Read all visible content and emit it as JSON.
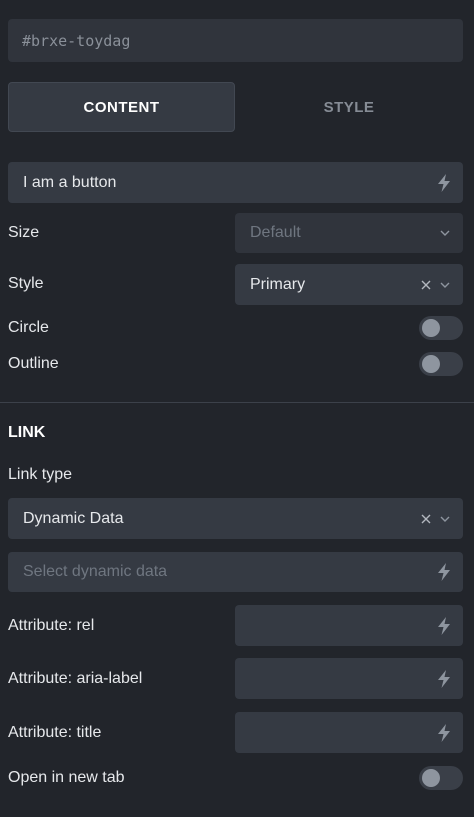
{
  "element_id": "#brxe-toydag",
  "tabs": [
    {
      "label": "CONTENT",
      "active": true
    },
    {
      "label": "STYLE",
      "active": false
    }
  ],
  "button_text": {
    "value": "I am a button"
  },
  "size": {
    "label": "Size",
    "placeholder": "Default"
  },
  "style": {
    "label": "Style",
    "value": "Primary"
  },
  "circle": {
    "label": "Circle",
    "on": false
  },
  "outline": {
    "label": "Outline",
    "on": false
  },
  "link": {
    "section_title": "LINK",
    "link_type_label": "Link type",
    "link_type_value": "Dynamic Data",
    "dynamic_data_placeholder": "Select dynamic data",
    "attr_rel_label": "Attribute: rel",
    "attr_aria_label": "Attribute: aria-label",
    "attr_title_label": "Attribute: title",
    "new_tab_label": "Open in new tab",
    "new_tab_on": false
  },
  "icons": {
    "dynamic_data": "bolt-icon",
    "dropdown": "chevron-down-icon",
    "clear": "close-icon"
  },
  "colors": {
    "background": "#22252b",
    "field": "#353a43",
    "text": "#e6e8eb",
    "muted": "#868c95"
  }
}
